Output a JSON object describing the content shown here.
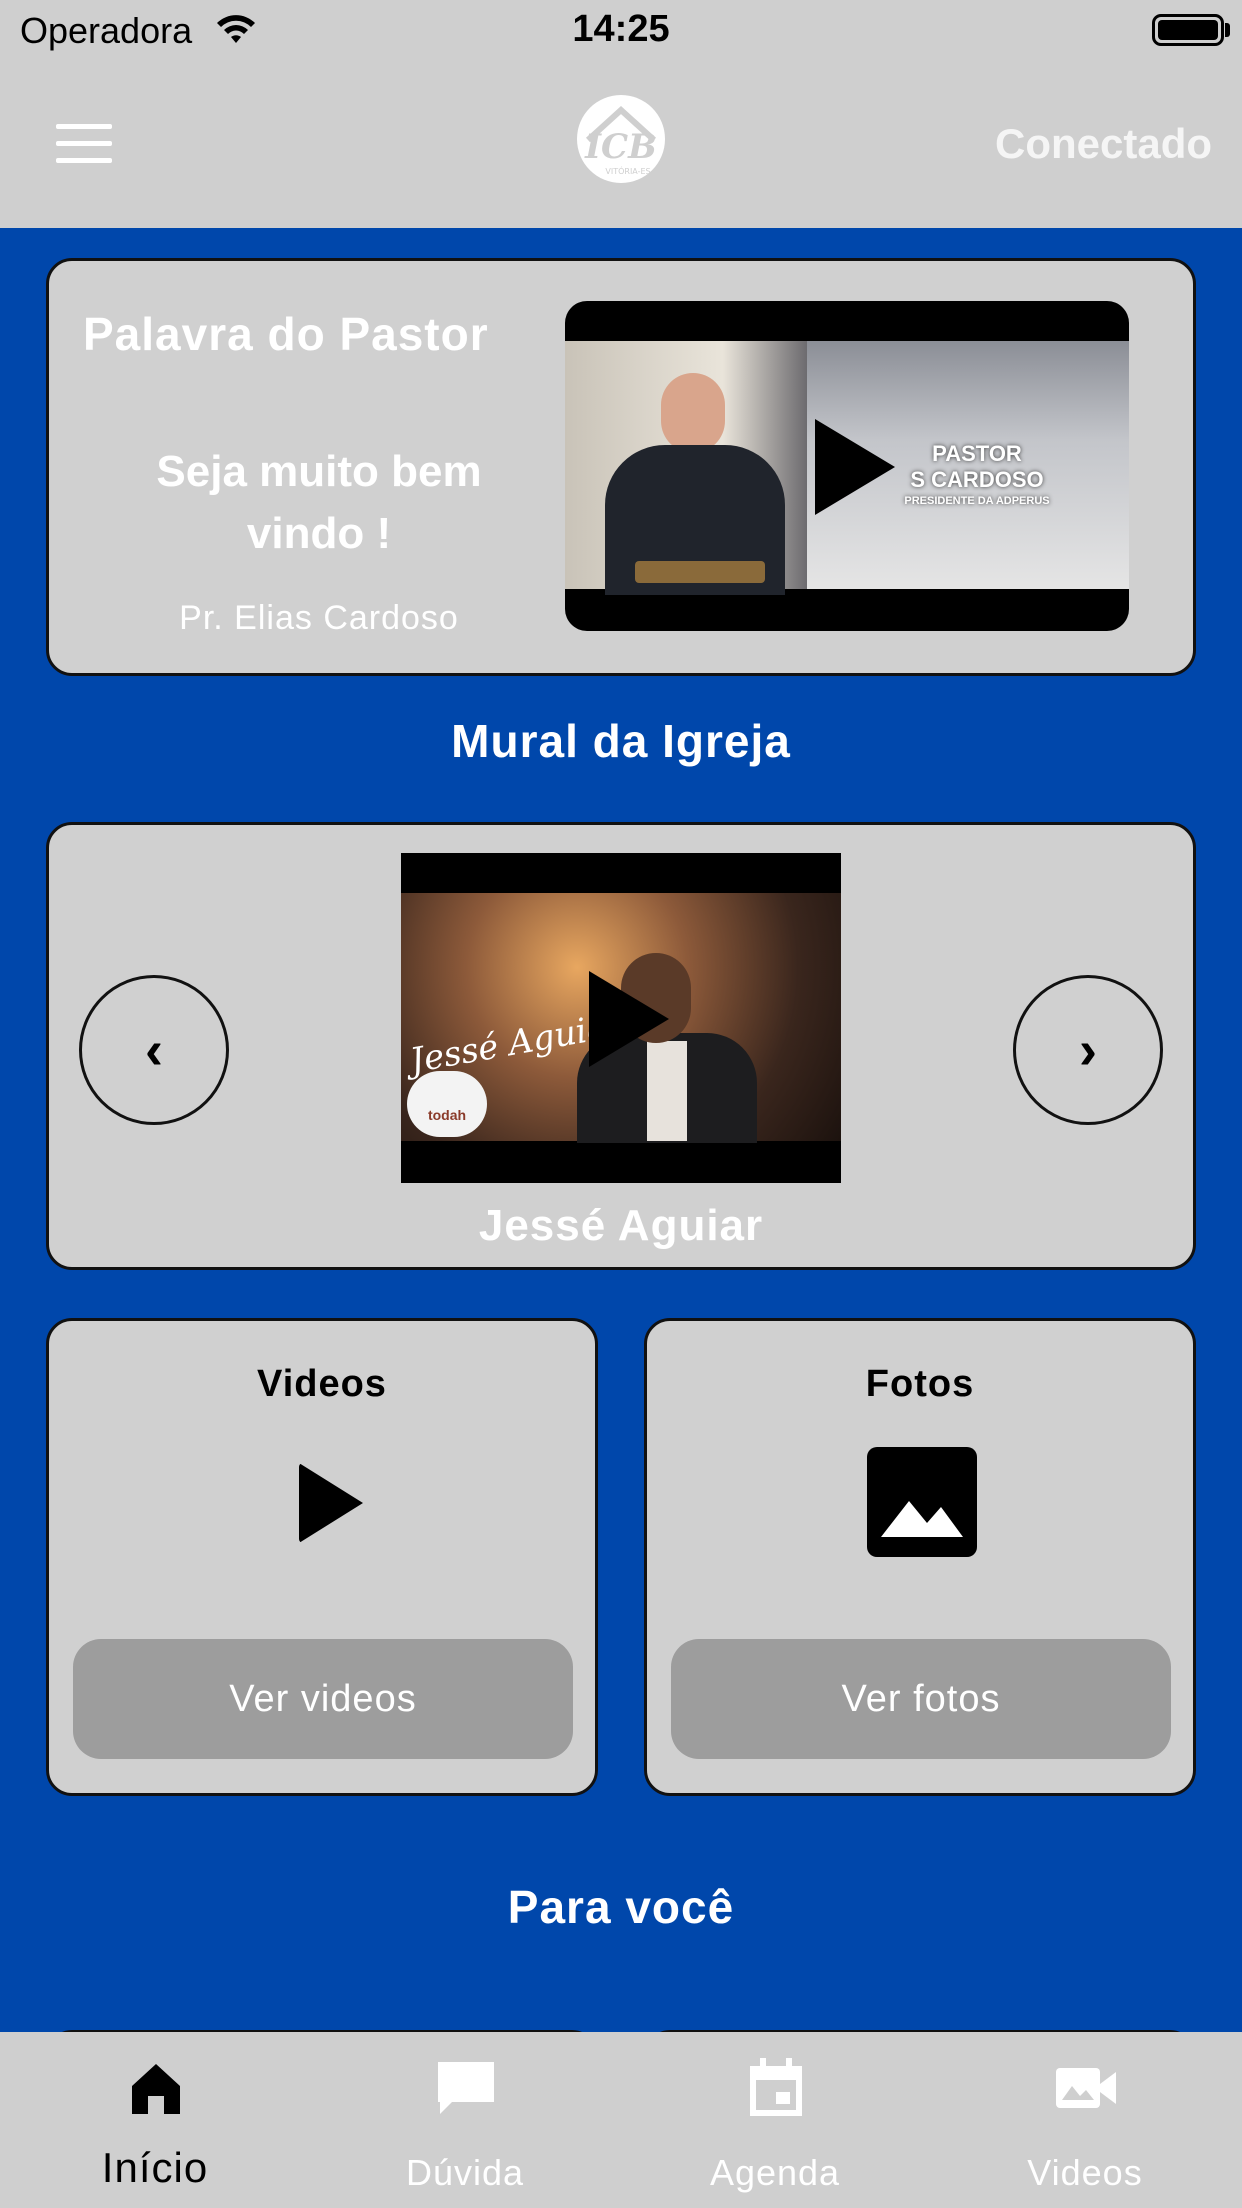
{
  "status_bar": {
    "carrier": "Operadora",
    "time": "14:25"
  },
  "header": {
    "logo_text": "ICB",
    "logo_subtext": "VITÓRIA-ES",
    "status": "Conectado"
  },
  "pastor": {
    "title": "Palavra do Pastor",
    "welcome": "Seja muito bem vindo !",
    "name": "Pr. Elias Cardoso",
    "video_banner_line1": "PASTOR",
    "video_banner_line2": "S CARDOSO",
    "video_banner_line3": "PRESIDENTE DA ADPERUS"
  },
  "mural": {
    "title": "Mural da Igreja",
    "caption": "Jessé Aguiar",
    "video_script": "Jessé Aguiar",
    "video_badge": "todah",
    "prev_icon": "chevron-left-icon",
    "next_icon": "chevron-right-icon"
  },
  "cards": {
    "videos": {
      "title": "Videos",
      "button": "Ver videos",
      "icon": "play-icon"
    },
    "fotos": {
      "title": "Fotos",
      "button": "Ver fotos",
      "icon": "image-icon"
    }
  },
  "para_voce": {
    "title": "Para você"
  },
  "tabbar": {
    "active": "Início",
    "items": [
      {
        "label": "Início",
        "icon": "home-icon"
      },
      {
        "label": "Dúvida",
        "icon": "chat-bubble-icon"
      },
      {
        "label": "Agenda",
        "icon": "calendar-icon"
      },
      {
        "label": "Videos",
        "icon": "video-camera-icon"
      }
    ]
  },
  "colors": {
    "background": "#0047ab",
    "bar": "#cfcfcf",
    "card": "#d0d0d0",
    "button": "#9d9d9d"
  }
}
